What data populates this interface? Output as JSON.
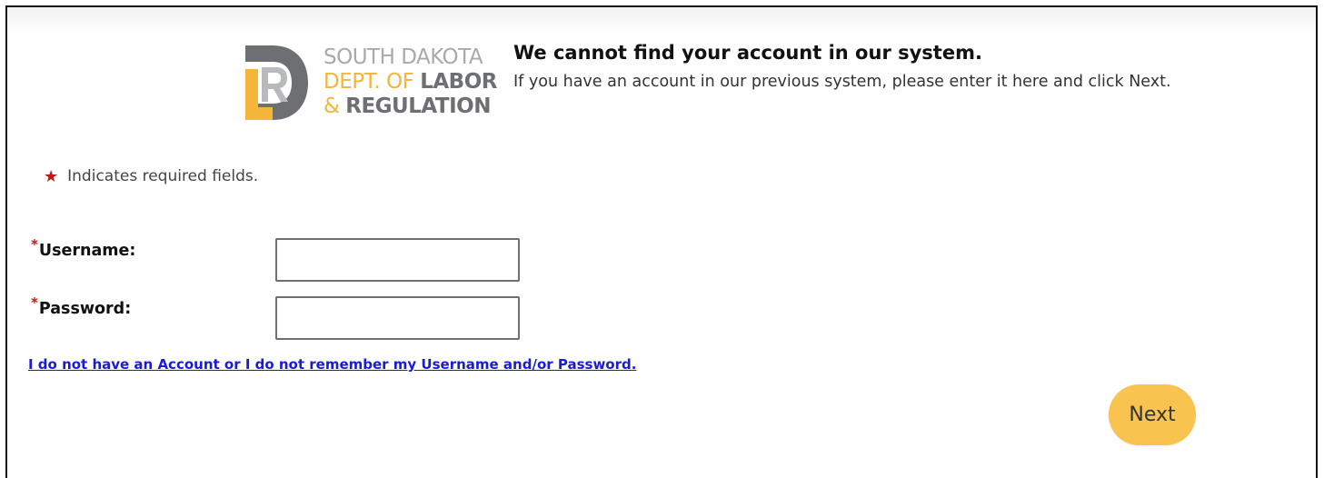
{
  "logo": {
    "line1": "SOUTH DAKOTA",
    "line2_thin": "DEPT. OF",
    "line2_bold": "LABOR",
    "line3_thin": "&",
    "line3_bold": "REGULATION"
  },
  "header": {
    "title": "We cannot find your account in our system.",
    "subtitle": "If you have an account in our previous system, please enter it here and click Next."
  },
  "required_note": {
    "star": "★",
    "text": "Indicates required fields."
  },
  "form": {
    "username": {
      "required_mark": "*",
      "label": "Username:",
      "value": "",
      "placeholder": ""
    },
    "password": {
      "required_mark": "*",
      "label": "Password:",
      "value": "",
      "placeholder": ""
    }
  },
  "help_link": "I do not have an Account or I do not remember my Username and/or Password.",
  "next_button": "Next",
  "colors": {
    "accent_gold": "#f5b43a",
    "button_yellow": "#f8c34f",
    "logo_grey": "#6d6f73",
    "required_red": "#c01818",
    "link_blue": "#1a1adb"
  }
}
